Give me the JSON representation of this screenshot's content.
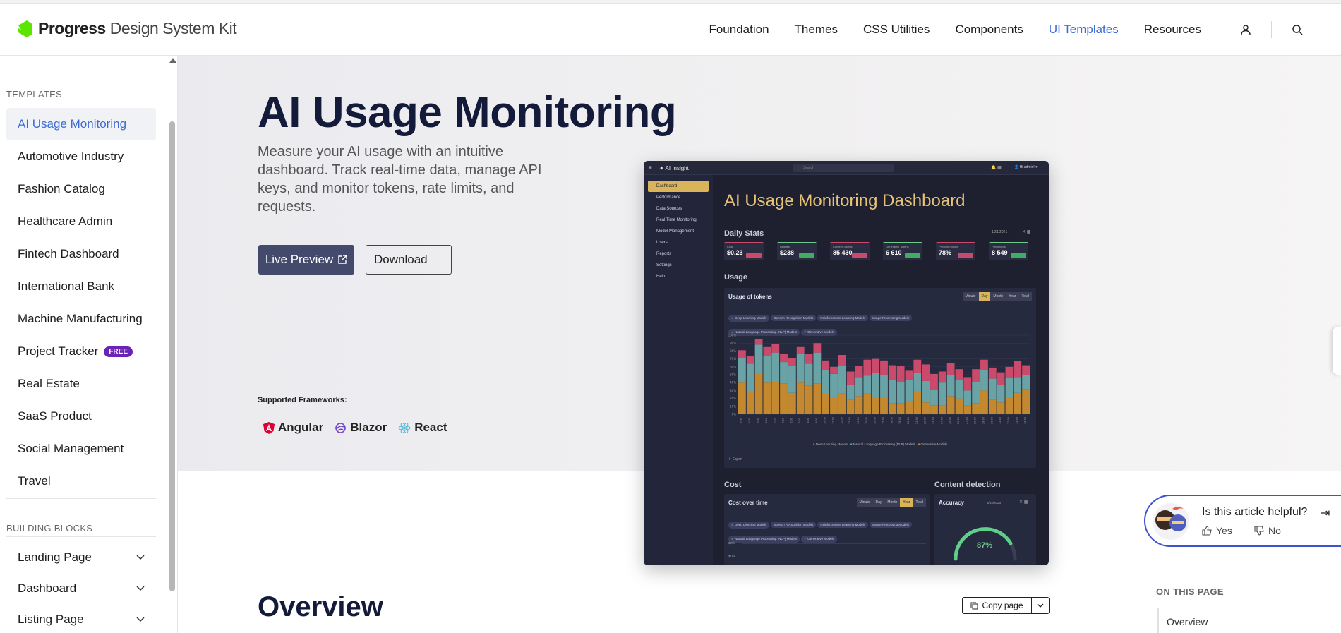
{
  "header": {
    "brand": "Progress",
    "product": "Design System Kit",
    "nav": [
      "Foundation",
      "Themes",
      "CSS Utilities",
      "Components",
      "UI Templates",
      "Resources"
    ],
    "active_nav": "UI Templates"
  },
  "sidebar": {
    "section_templates": "TEMPLATES",
    "items": [
      {
        "label": "AI Usage Monitoring",
        "active": true
      },
      {
        "label": "Automotive Industry"
      },
      {
        "label": "Fashion Catalog"
      },
      {
        "label": "Healthcare Admin"
      },
      {
        "label": "Fintech Dashboard"
      },
      {
        "label": "International Bank"
      },
      {
        "label": "Machine Manufacturing"
      },
      {
        "label": "Project Tracker",
        "badge": "FREE"
      },
      {
        "label": "Real Estate"
      },
      {
        "label": "SaaS Product"
      },
      {
        "label": "Social Management"
      },
      {
        "label": "Travel"
      }
    ],
    "section_blocks": "BUILDING BLOCKS",
    "blocks": [
      "Landing Page",
      "Dashboard",
      "Listing Page"
    ]
  },
  "hero": {
    "title": "AI Usage Monitoring",
    "description": "Measure your AI usage with an intuitive dashboard. Track real-time data, manage API keys, and monitor tokens, rate limits, and requests.",
    "live_preview": "Live Preview",
    "download": "Download",
    "frameworks_label": "Supported Frameworks:",
    "frameworks": [
      "Angular",
      "Blazor",
      "React"
    ]
  },
  "preview": {
    "app_name": "AI Insight",
    "search_placeholder": "Search",
    "user": "Hi admin!",
    "menu": [
      "Dashboard",
      "Performance",
      "Data Sources",
      "Real Time Monitoring",
      "Model Management",
      "Users",
      "Reports",
      "Settings",
      "Help"
    ],
    "title": "AI Usage Monitoring Dashboard",
    "daily_stats": "Daily Stats",
    "date": "1/21/2021",
    "stats": [
      {
        "label": "Cost",
        "value": "$0.23",
        "trend": "down"
      },
      {
        "label": "Request",
        "value": "$238",
        "trend": "up"
      },
      {
        "label": "Context Tokens",
        "value": "85 430",
        "trend": "down"
      },
      {
        "label": "Generated Tokens",
        "value": "6 610",
        "trend": "up"
      },
      {
        "label": "Precision Value",
        "value": "78%",
        "trend": "down"
      },
      {
        "label": "Predictions",
        "value": "8 549",
        "trend": "up"
      }
    ],
    "usage": "Usage",
    "usage_panel": "Usage of tokens",
    "usage_tabs": [
      "Minute",
      "Day",
      "Month",
      "Year",
      "Total"
    ],
    "usage_tab_active": "Day",
    "chips": [
      "Deep Learning Models",
      "Speech Recognition Models",
      "Reinforcement Learning Models",
      "Image Processing Models",
      "Natural Language Processing (NLP) Models",
      "Generative Models"
    ],
    "legend": [
      "Deep Learning Models",
      "Natural Language Processing (NLP) Models",
      "Generative Models"
    ],
    "export": "Export",
    "cost": "Cost",
    "cost_panel": "Cost over time",
    "cost_tabs": [
      "Minute",
      "Day",
      "Month",
      "Year",
      "Total"
    ],
    "cost_tab_active": "Year",
    "cost_chips": [
      "Deep Learning Models",
      "Speech Recognition Models",
      "Reinforcement Learning Models",
      "Image Processing Models",
      "Natural Language Processing (NLP) Models",
      "Generative Models"
    ],
    "cost_ticks": [
      "$20k",
      "$15k"
    ],
    "content_detection": "Content detection",
    "accuracy": "Accuracy",
    "accuracy_date": "6/14/2023",
    "accuracy_value": "87%",
    "colors": {
      "deep": "#c94a6a",
      "nlp": "#6aa3a6",
      "gen": "#c4892e"
    },
    "y_ticks": [
      "100%",
      "90%",
      "80%",
      "70%",
      "60%",
      "50%",
      "40%",
      "30%",
      "20%",
      "10%",
      "0%"
    ],
    "x_ticks": [
      "0:00",
      "1:00",
      "2:00",
      "3:00",
      "4:00",
      "5:00",
      "6:00",
      "7:00",
      "8:00",
      "9:00",
      "10:00",
      "11:00",
      "12:00",
      "13:00",
      "14:00",
      "15:00",
      "16:00",
      "17:00",
      "18:00",
      "19:00",
      "20:00",
      "21:00",
      "22:00",
      "23:00"
    ]
  },
  "chart_data": {
    "type": "bar",
    "title": "Usage of tokens",
    "categories": [
      "0:00",
      "1:00",
      "2:00",
      "3:00",
      "4:00",
      "5:00",
      "6:00",
      "7:00",
      "8:00",
      "9:00",
      "10:00",
      "11:00",
      "12:00",
      "13:00",
      "14:00",
      "15:00",
      "16:00",
      "17:00",
      "18:00",
      "19:00",
      "20:00",
      "21:00",
      "22:00",
      "23:00",
      "24:00",
      "25:00",
      "26:00",
      "27:00",
      "28:00",
      "29:00",
      "30:00",
      "31:00",
      "32:00",
      "33:00",
      "34:00"
    ],
    "stacked": true,
    "ylim": [
      0,
      100
    ],
    "series": [
      {
        "name": "Generative Models",
        "values": [
          40,
          28,
          52,
          40,
          41,
          39,
          27,
          40,
          36,
          39,
          25,
          21,
          26,
          18,
          23,
          26,
          22,
          21,
          14,
          14,
          17,
          29,
          15,
          11,
          11,
          23,
          20,
          11,
          14,
          30,
          18,
          15,
          22,
          27,
          32
        ]
      },
      {
        "name": "Natural Language Processing (NLP) Models",
        "values": [
          31,
          36,
          36,
          34,
          37,
          27,
          34,
          36,
          28,
          39,
          31,
          30,
          35,
          19,
          24,
          23,
          30,
          29,
          29,
          27,
          26,
          23,
          27,
          20,
          29,
          27,
          23,
          19,
          27,
          26,
          27,
          22,
          24,
          20,
          18
        ]
      },
      {
        "name": "Deep Learning Models",
        "values": [
          10,
          10,
          7,
          11,
          11,
          10,
          10,
          9,
          12,
          12,
          12,
          9,
          14,
          17,
          14,
          20,
          18,
          18,
          19,
          20,
          12,
          17,
          21,
          20,
          14,
          15,
          14,
          17,
          16,
          13,
          14,
          16,
          14,
          20,
          12
        ]
      }
    ]
  },
  "overview": {
    "title": "Overview",
    "copy_page": "Copy page",
    "on_this_page": "ON THIS PAGE",
    "otp_items": [
      "Overview"
    ]
  },
  "feedback": {
    "question": "Is this article helpful?",
    "yes": "Yes",
    "no": "No"
  }
}
